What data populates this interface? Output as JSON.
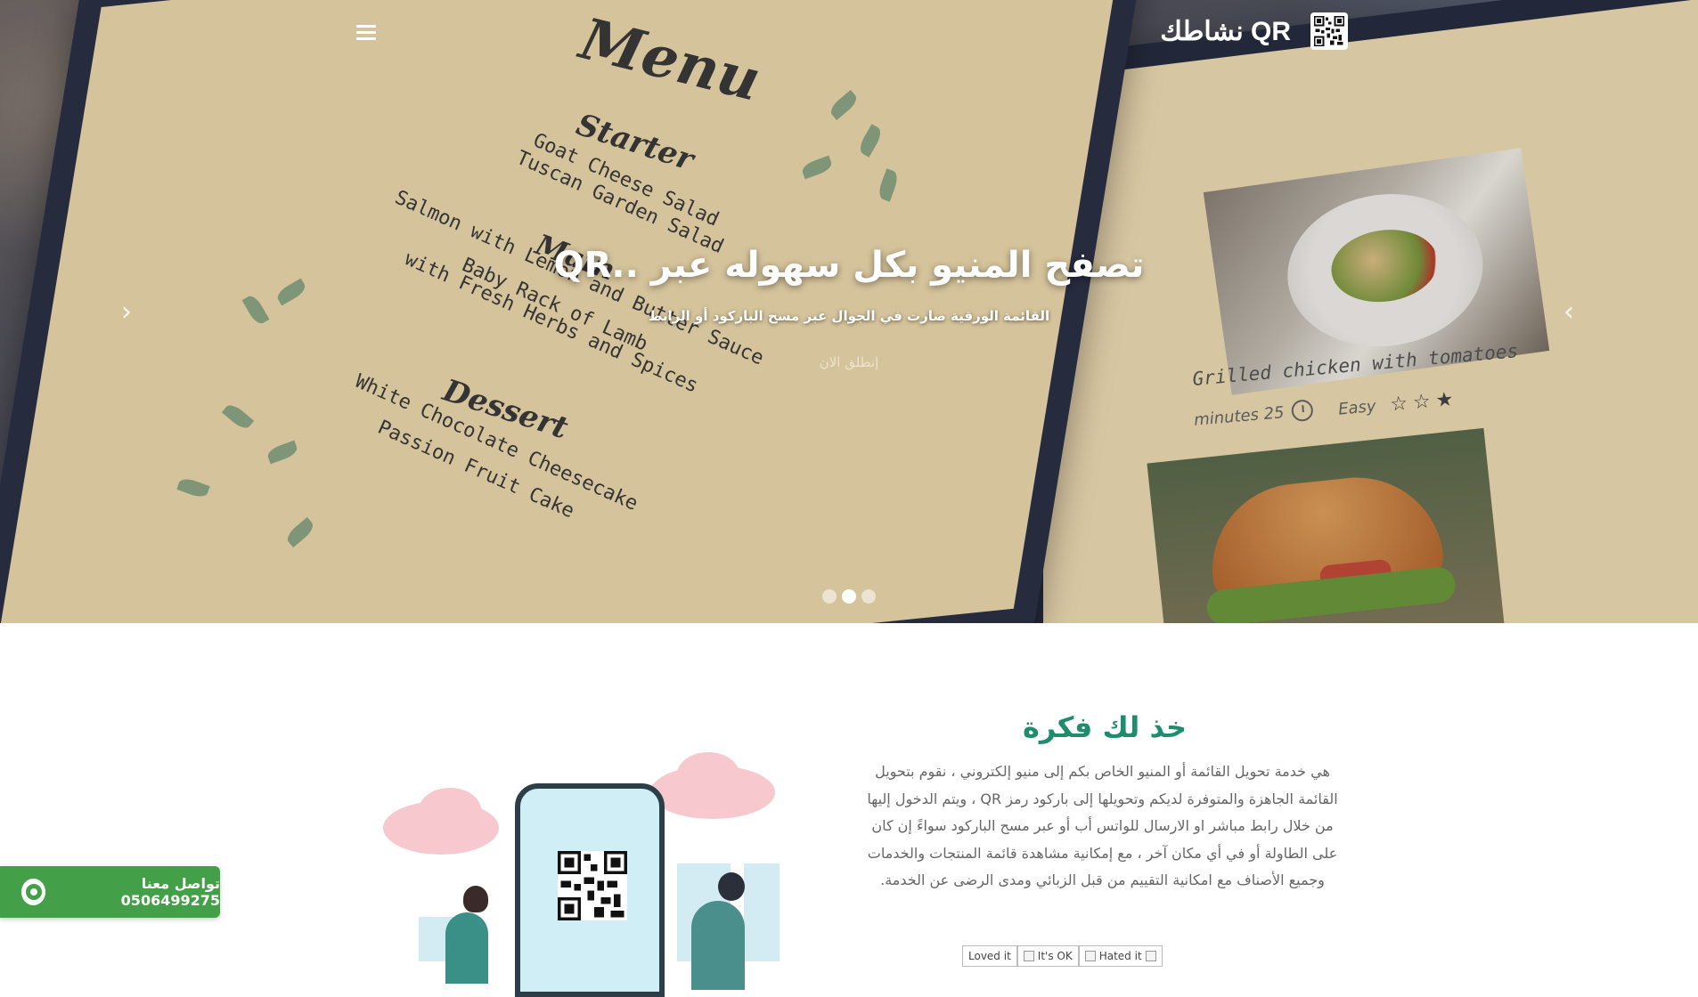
{
  "nav": {
    "brand": "QR نشاطك",
    "menu_icon": "hamburger-icon",
    "logo_icon": "qr-code-icon"
  },
  "hero": {
    "title": "تصفح المنيو بكل سهوله عبر ..QR",
    "subtitle": "القائمة الورقية صارت في الجوال عبر مسح الباركود أو الرابط",
    "cta": "إنطلق الان",
    "prev_icon": "chevron-left-icon",
    "next_icon": "chevron-right-icon",
    "slides": 3,
    "active_slide": 2,
    "image_text": {
      "menu_title": "Menu",
      "starter_heading": "Starter",
      "starter_items": [
        "Goat Cheese Salad",
        "Tuscan Garden Salad"
      ],
      "main_heading": "Main",
      "main_items": [
        "Salmon with Lemon and Butter Sauce",
        "Baby Rack of Lamb",
        "with Fresh Herbs and Spices"
      ],
      "dessert_heading": "Dessert",
      "dessert_items": [
        "White Chocolate Cheesecake",
        "Passion Fruit Cake"
      ],
      "dish_caption": "Grilled chicken with tomatoes",
      "dish_time": "25 minutes",
      "dish_level": "Easy"
    }
  },
  "idea": {
    "title": "خذ لك فكرة",
    "body": "هي خدمة تحويل القائمة أو المنيو الخاص بكم إلى منيو إلكتروني ، نقوم بتحويل القائمة الجاهزة والمتوفرة لديكم وتحويلها إلى باركود رمز QR ، ويتم الدخول إليها من خلال رابط مباشر او الارسال للواتس أب أو عبر مسح الباركود سواءً إن كان على الطاولة أو في أي مكان آخر ، مع إمكانية مشاهدة قائمة المنتجات والخدمات وجميع الأصناف مع امكانية التقييم من قبل الزبائي ومدى الرضى عن الخدمة.",
    "ratings": [
      "Loved it",
      "It's OK",
      "Hated it"
    ]
  },
  "whatsapp": {
    "label": "تواصل معنا 0506499275",
    "icon": "whatsapp-icon",
    "color": "#43a048"
  },
  "colors": {
    "accent": "#1f8c6e",
    "hero_text": "#ffffff"
  }
}
